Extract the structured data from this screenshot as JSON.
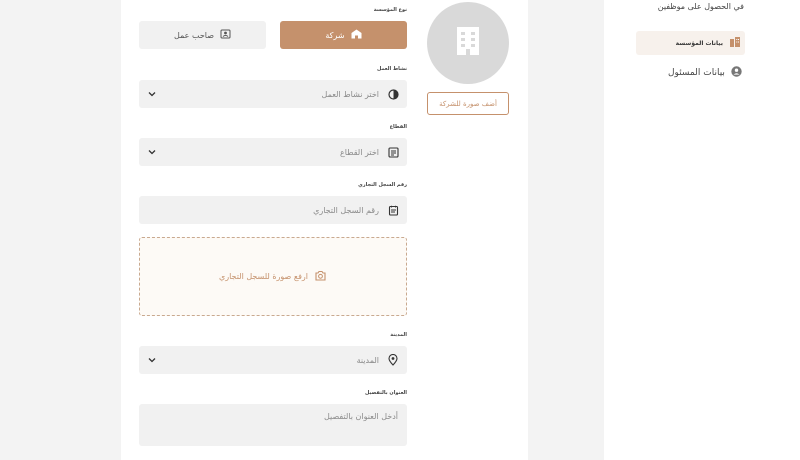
{
  "sidebar": {
    "top_text": "في الحصول على موظفين",
    "items": [
      {
        "label": "بيانات المؤسسة",
        "icon": "building-icon",
        "active": true
      },
      {
        "label": "بيانات المسئول",
        "icon": "user-circle-icon",
        "active": false
      }
    ]
  },
  "form": {
    "org_type": {
      "label": "نوع المؤسسة",
      "company": "شركة",
      "employer": "صاحب عمل",
      "selected": "شركة"
    },
    "activity": {
      "label": "نشاط العمل",
      "placeholder": "اختر نشاط العمل"
    },
    "sector": {
      "label": "القطاع",
      "placeholder": "اختر القطاع"
    },
    "cr_number": {
      "label": "رقم السجل التجاري",
      "placeholder": "رقم السجل التجاري"
    },
    "cr_upload": {
      "text": "ارفع صورة للسجل التجاري"
    },
    "city": {
      "label": "المدينة",
      "placeholder": "المدينة"
    },
    "address": {
      "label": "العنوان بالتفصيل",
      "placeholder": "أدخل العنوان بالتفصيل"
    }
  },
  "company_photo": {
    "button": "أضف صورة للشركة"
  },
  "colors": {
    "accent": "#c5916c",
    "field_bg": "#f1f1f1",
    "avatar_bg": "#d9d9d9"
  }
}
